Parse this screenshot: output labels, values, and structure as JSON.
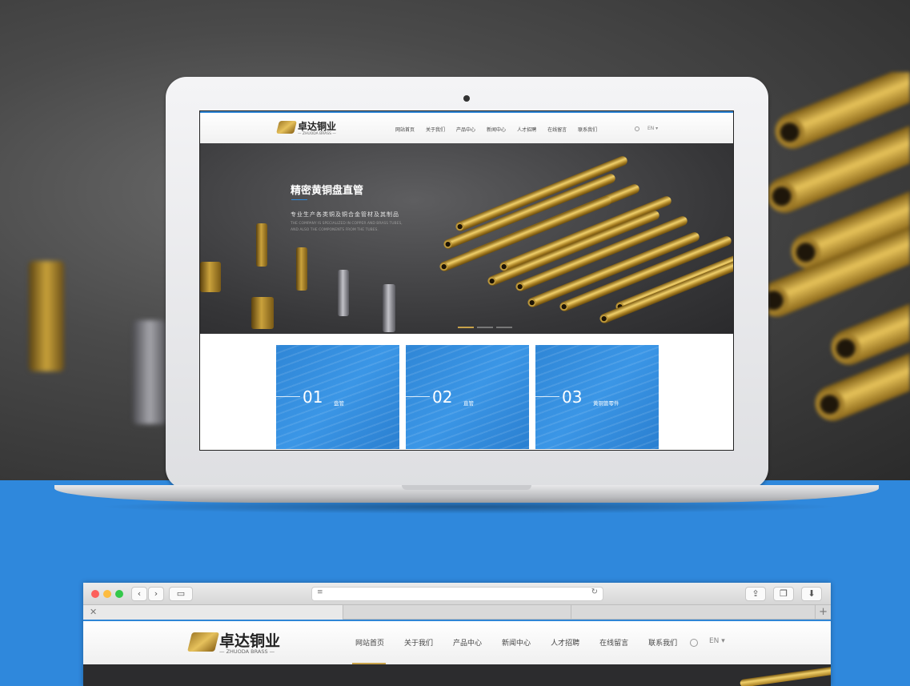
{
  "colors": {
    "accent_blue": "#2f86d6",
    "gold": "#c8a24a",
    "dark_hero": "#363638"
  },
  "site": {
    "logo": {
      "name": "卓达铜业",
      "sub": "— ZHUODA BRASS —",
      "icon": "zhuoda-logo-icon"
    },
    "nav": [
      "网站首页",
      "关于我们",
      "产品中心",
      "新闻中心",
      "人才招聘",
      "在线留言",
      "联系我们"
    ],
    "active_nav": "网站首页",
    "lang": "EN ▾",
    "hero": {
      "title": "精密黄铜盘直管",
      "subtitle": "专业生产各类铜及铜合金管材及其制品",
      "en_line1": "THE COMPANY IS SPECIALIZED IN COPPER AND BRASS TUBES,",
      "en_line2": "AND ALSO THE COMPONENTS FROM THE TUBES.",
      "slides": 3,
      "active_slide": 1
    },
    "cards": [
      {
        "num": "01",
        "label": "盘管"
      },
      {
        "num": "02",
        "label": "直管"
      },
      {
        "num": "03",
        "label": "黄铜管零件"
      }
    ]
  },
  "browser": {
    "icons": [
      "close-light",
      "minimize-light",
      "zoom-light",
      "back-icon",
      "forward-icon",
      "sidebar-icon",
      "reader-icon",
      "reload-icon",
      "share-icon",
      "tabs-icon",
      "download-icon"
    ],
    "tab_close": "✕",
    "new_tab": "+"
  }
}
